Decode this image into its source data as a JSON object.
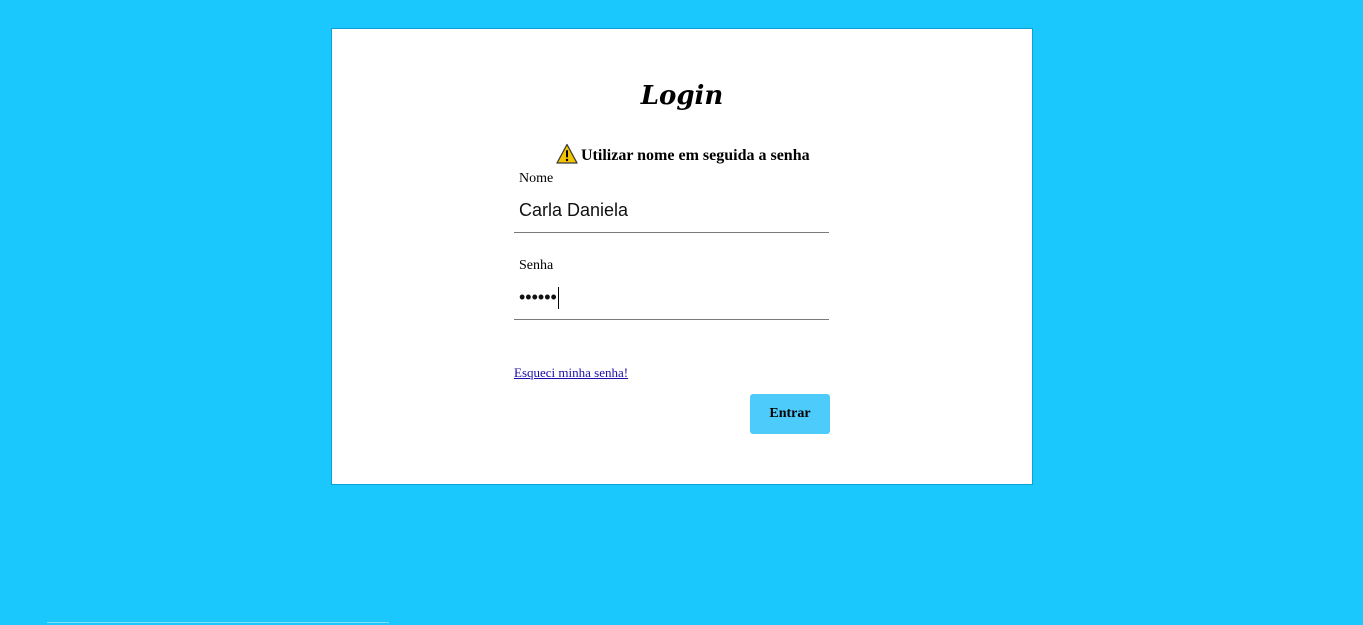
{
  "page": {
    "title": "Login",
    "background_color": "#1ac8fe"
  },
  "notice": {
    "icon": "warning-icon",
    "text": "Utilizar nome em seguida a senha"
  },
  "form": {
    "nome": {
      "label": "Nome",
      "value": "Carla Daniela"
    },
    "senha": {
      "label": "Senha",
      "masked_value": "••••••"
    },
    "forgot_link": "Esqueci minha senha!",
    "submit_label": "Entrar"
  },
  "colors": {
    "button": "#4dccfc",
    "link": "#1a0dab",
    "card": "#ffffff"
  }
}
